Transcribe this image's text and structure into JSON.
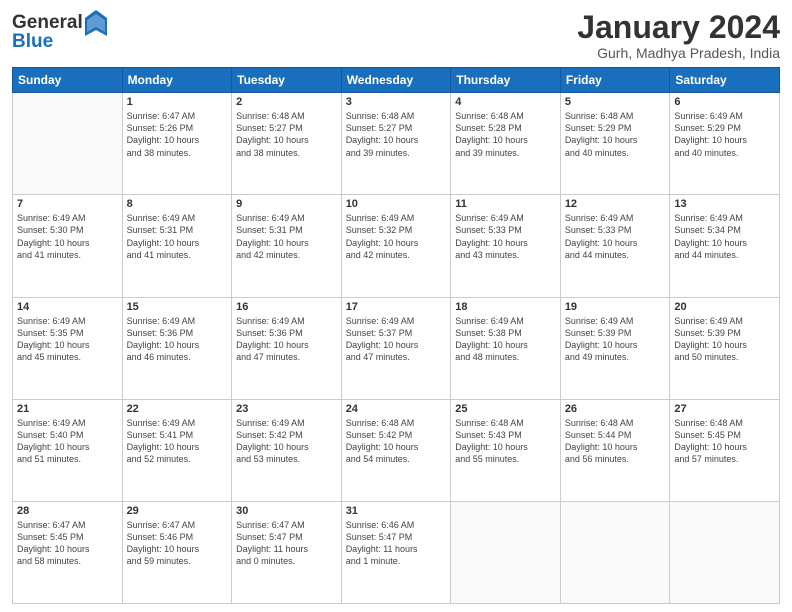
{
  "header": {
    "logo_general": "General",
    "logo_blue": "Blue",
    "month": "January 2024",
    "location": "Gurh, Madhya Pradesh, India"
  },
  "weekdays": [
    "Sunday",
    "Monday",
    "Tuesday",
    "Wednesday",
    "Thursday",
    "Friday",
    "Saturday"
  ],
  "weeks": [
    [
      {
        "day": "",
        "info": ""
      },
      {
        "day": "1",
        "info": "Sunrise: 6:47 AM\nSunset: 5:26 PM\nDaylight: 10 hours\nand 38 minutes."
      },
      {
        "day": "2",
        "info": "Sunrise: 6:48 AM\nSunset: 5:27 PM\nDaylight: 10 hours\nand 38 minutes."
      },
      {
        "day": "3",
        "info": "Sunrise: 6:48 AM\nSunset: 5:27 PM\nDaylight: 10 hours\nand 39 minutes."
      },
      {
        "day": "4",
        "info": "Sunrise: 6:48 AM\nSunset: 5:28 PM\nDaylight: 10 hours\nand 39 minutes."
      },
      {
        "day": "5",
        "info": "Sunrise: 6:48 AM\nSunset: 5:29 PM\nDaylight: 10 hours\nand 40 minutes."
      },
      {
        "day": "6",
        "info": "Sunrise: 6:49 AM\nSunset: 5:29 PM\nDaylight: 10 hours\nand 40 minutes."
      }
    ],
    [
      {
        "day": "7",
        "info": "Sunrise: 6:49 AM\nSunset: 5:30 PM\nDaylight: 10 hours\nand 41 minutes."
      },
      {
        "day": "8",
        "info": "Sunrise: 6:49 AM\nSunset: 5:31 PM\nDaylight: 10 hours\nand 41 minutes."
      },
      {
        "day": "9",
        "info": "Sunrise: 6:49 AM\nSunset: 5:31 PM\nDaylight: 10 hours\nand 42 minutes."
      },
      {
        "day": "10",
        "info": "Sunrise: 6:49 AM\nSunset: 5:32 PM\nDaylight: 10 hours\nand 42 minutes."
      },
      {
        "day": "11",
        "info": "Sunrise: 6:49 AM\nSunset: 5:33 PM\nDaylight: 10 hours\nand 43 minutes."
      },
      {
        "day": "12",
        "info": "Sunrise: 6:49 AM\nSunset: 5:33 PM\nDaylight: 10 hours\nand 44 minutes."
      },
      {
        "day": "13",
        "info": "Sunrise: 6:49 AM\nSunset: 5:34 PM\nDaylight: 10 hours\nand 44 minutes."
      }
    ],
    [
      {
        "day": "14",
        "info": "Sunrise: 6:49 AM\nSunset: 5:35 PM\nDaylight: 10 hours\nand 45 minutes."
      },
      {
        "day": "15",
        "info": "Sunrise: 6:49 AM\nSunset: 5:36 PM\nDaylight: 10 hours\nand 46 minutes."
      },
      {
        "day": "16",
        "info": "Sunrise: 6:49 AM\nSunset: 5:36 PM\nDaylight: 10 hours\nand 47 minutes."
      },
      {
        "day": "17",
        "info": "Sunrise: 6:49 AM\nSunset: 5:37 PM\nDaylight: 10 hours\nand 47 minutes."
      },
      {
        "day": "18",
        "info": "Sunrise: 6:49 AM\nSunset: 5:38 PM\nDaylight: 10 hours\nand 48 minutes."
      },
      {
        "day": "19",
        "info": "Sunrise: 6:49 AM\nSunset: 5:39 PM\nDaylight: 10 hours\nand 49 minutes."
      },
      {
        "day": "20",
        "info": "Sunrise: 6:49 AM\nSunset: 5:39 PM\nDaylight: 10 hours\nand 50 minutes."
      }
    ],
    [
      {
        "day": "21",
        "info": "Sunrise: 6:49 AM\nSunset: 5:40 PM\nDaylight: 10 hours\nand 51 minutes."
      },
      {
        "day": "22",
        "info": "Sunrise: 6:49 AM\nSunset: 5:41 PM\nDaylight: 10 hours\nand 52 minutes."
      },
      {
        "day": "23",
        "info": "Sunrise: 6:49 AM\nSunset: 5:42 PM\nDaylight: 10 hours\nand 53 minutes."
      },
      {
        "day": "24",
        "info": "Sunrise: 6:48 AM\nSunset: 5:42 PM\nDaylight: 10 hours\nand 54 minutes."
      },
      {
        "day": "25",
        "info": "Sunrise: 6:48 AM\nSunset: 5:43 PM\nDaylight: 10 hours\nand 55 minutes."
      },
      {
        "day": "26",
        "info": "Sunrise: 6:48 AM\nSunset: 5:44 PM\nDaylight: 10 hours\nand 56 minutes."
      },
      {
        "day": "27",
        "info": "Sunrise: 6:48 AM\nSunset: 5:45 PM\nDaylight: 10 hours\nand 57 minutes."
      }
    ],
    [
      {
        "day": "28",
        "info": "Sunrise: 6:47 AM\nSunset: 5:45 PM\nDaylight: 10 hours\nand 58 minutes."
      },
      {
        "day": "29",
        "info": "Sunrise: 6:47 AM\nSunset: 5:46 PM\nDaylight: 10 hours\nand 59 minutes."
      },
      {
        "day": "30",
        "info": "Sunrise: 6:47 AM\nSunset: 5:47 PM\nDaylight: 11 hours\nand 0 minutes."
      },
      {
        "day": "31",
        "info": "Sunrise: 6:46 AM\nSunset: 5:47 PM\nDaylight: 11 hours\nand 1 minute."
      },
      {
        "day": "",
        "info": ""
      },
      {
        "day": "",
        "info": ""
      },
      {
        "day": "",
        "info": ""
      }
    ]
  ]
}
